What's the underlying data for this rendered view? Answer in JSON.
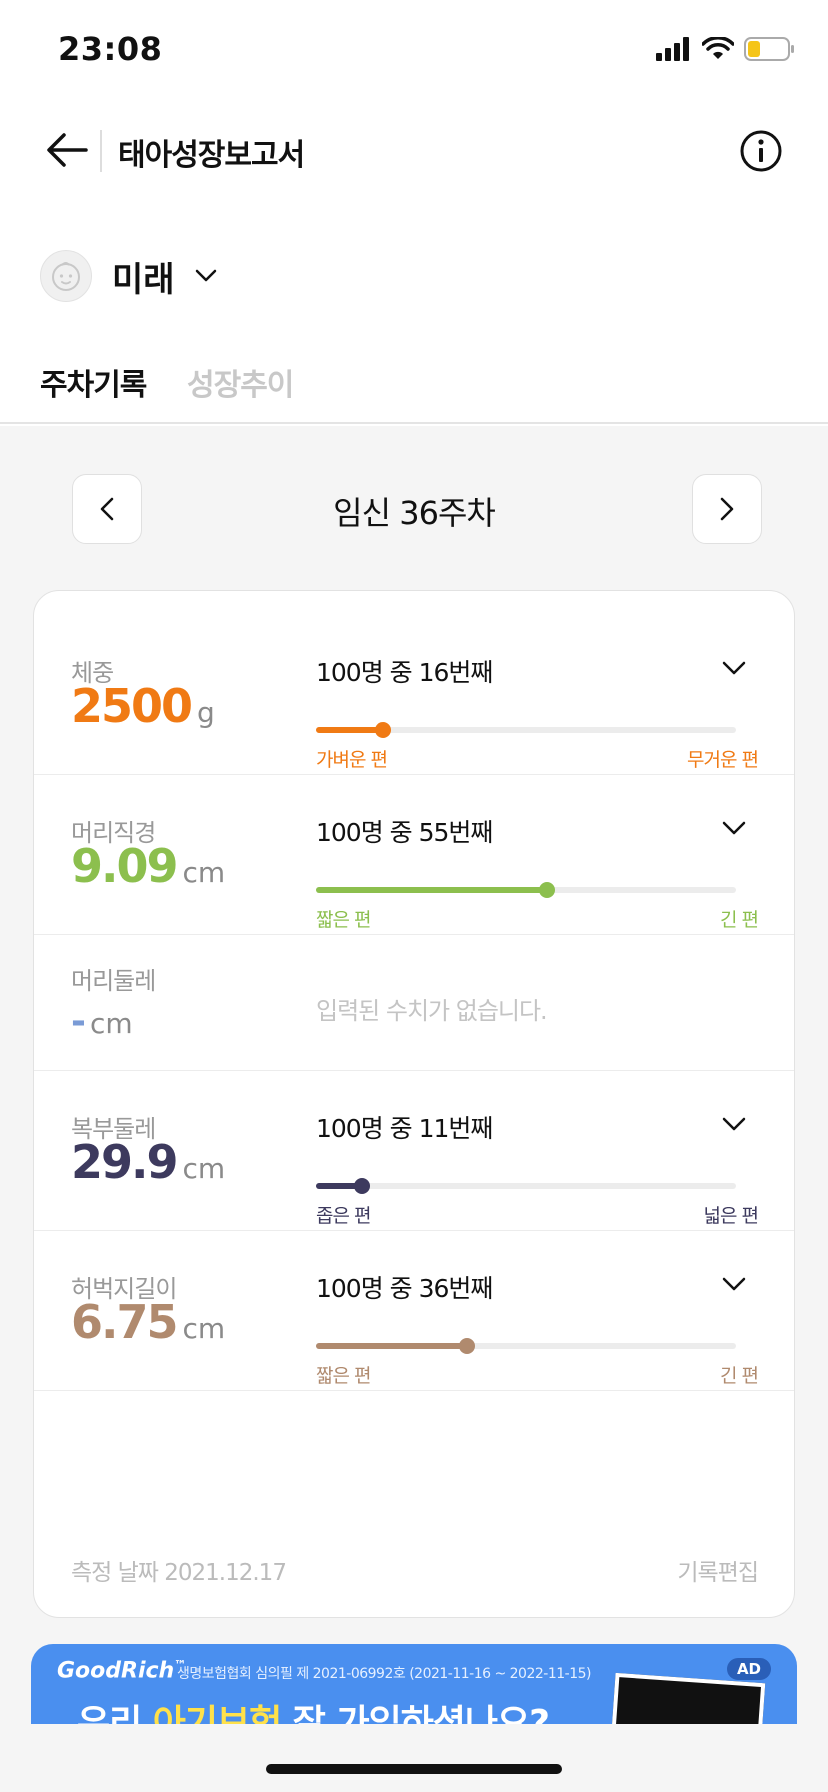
{
  "status_bar": {
    "time": "23:08",
    "battery_color": "#f5c518"
  },
  "header": {
    "title": "태아성장보고서"
  },
  "profile": {
    "name": "미래"
  },
  "tabs": [
    {
      "label": "주차기록",
      "active": true
    },
    {
      "label": "성장추이",
      "active": false
    }
  ],
  "week": {
    "label": "임신 36주차"
  },
  "measurements": [
    {
      "label": "체중",
      "value": "2500",
      "unit": "g",
      "rank": "100명 중 16번째",
      "percentile": 0.16,
      "left_label": "가벼운 편",
      "right_label": "무거운 편",
      "color": "#f07a14"
    },
    {
      "label": "머리직경",
      "value": "9.09",
      "unit": "cm",
      "rank": "100명 중 55번째",
      "percentile": 0.55,
      "left_label": "짧은 편",
      "right_label": "긴 편",
      "color": "#8cbf4e"
    },
    {
      "label": "머리둘레",
      "value": "-",
      "unit": "cm",
      "empty_message": "입력된 수치가 없습니다.",
      "color": "#7a9bd6"
    },
    {
      "label": "복부둘레",
      "value": "29.9",
      "unit": "cm",
      "rank": "100명 중 11번째",
      "percentile": 0.11,
      "left_label": "좁은 편",
      "right_label": "넓은 편",
      "color": "#3d3a5e"
    },
    {
      "label": "허벅지길이",
      "value": "6.75",
      "unit": "cm",
      "rank": "100명 중 36번째",
      "percentile": 0.36,
      "left_label": "짧은 편",
      "right_label": "긴 편",
      "color": "#b08a6e"
    }
  ],
  "footer": {
    "date": "측정 날짜 2021.12.17",
    "edit": "기록편집"
  },
  "ad": {
    "brand": "GoodRich",
    "brand_mark": "™",
    "notice": "생명보험협회 심의필 제 2021-06992호 (2021-11-16 ~ 2022-11-15)",
    "badge": "AD",
    "headline_pre": "우리 ",
    "headline_highlight": "아기보험",
    "headline_post": " 잘 가입하셨나요?"
  }
}
